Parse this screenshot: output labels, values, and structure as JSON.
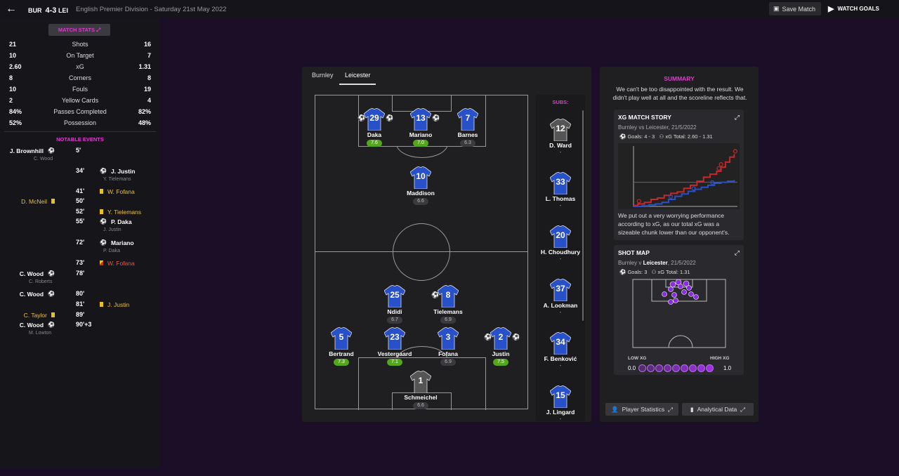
{
  "header": {
    "back_icon": "back-arrow-icon",
    "home_abbr": "BUR",
    "score": "4-3",
    "away_abbr": "LEI",
    "competition": "English Premier Division",
    "separator": " - ",
    "date": "Saturday 21st May 2022",
    "save_label": "Save Match",
    "watch_label": "WATCH GOALS"
  },
  "stats": {
    "title": "MATCH STATS",
    "rows": [
      {
        "home": "21",
        "label": "Shots",
        "away": "16"
      },
      {
        "home": "10",
        "label": "On Target",
        "away": "7"
      },
      {
        "home": "2.60",
        "label": "xG",
        "away": "1.31"
      },
      {
        "home": "8",
        "label": "Corners",
        "away": "8"
      },
      {
        "home": "10",
        "label": "Fouls",
        "away": "19"
      },
      {
        "home": "2",
        "label": "Yellow Cards",
        "away": "4"
      },
      {
        "home": "84%",
        "label": "Passes Completed",
        "away": "82%"
      },
      {
        "home": "52%",
        "label": "Possession",
        "away": "48%"
      }
    ]
  },
  "events": {
    "title": "NOTABLE EVENTS",
    "items": [
      {
        "side": "home",
        "name": "J. Brownhill",
        "type": "goal",
        "minute": "5'",
        "sub": "C. Wood"
      },
      {
        "side": "away",
        "name": "J. Justin",
        "type": "goal",
        "minute": "34'",
        "sub": "Y. Tielemans"
      },
      {
        "side": "away",
        "name": "W. Fofana",
        "type": "yellow",
        "minute": "41'",
        "sub": ""
      },
      {
        "side": "home",
        "name": "D. McNeil",
        "type": "yellow",
        "minute": "50'",
        "sub": ""
      },
      {
        "side": "away",
        "name": "Y. Tielemans",
        "type": "yellow",
        "minute": "52'",
        "sub": ""
      },
      {
        "side": "away",
        "name": "P. Daka",
        "type": "goal",
        "minute": "55'",
        "sub": "J. Justin"
      },
      {
        "side": "away",
        "name": "Mariano",
        "type": "goal",
        "minute": "72'",
        "sub": "P. Daka"
      },
      {
        "side": "away",
        "name": "W. Fofana",
        "type": "red",
        "minute": "73'",
        "sub": ""
      },
      {
        "side": "home",
        "name": "C. Wood",
        "type": "goal",
        "minute": "78'",
        "sub": "C. Roberts"
      },
      {
        "side": "home",
        "name": "C. Wood",
        "type": "goal",
        "minute": "80'",
        "sub": ""
      },
      {
        "side": "away",
        "name": "J. Justin",
        "type": "yellow",
        "minute": "81'",
        "sub": ""
      },
      {
        "side": "home",
        "name": "C. Taylor",
        "type": "yellow",
        "minute": "89'",
        "sub": ""
      },
      {
        "side": "home",
        "name": "C. Wood",
        "type": "goal",
        "minute": "90'+3",
        "sub": "M. Lowton"
      }
    ]
  },
  "tabs": [
    "Burnley",
    "Leicester"
  ],
  "active_tab": "Leicester",
  "players": [
    {
      "name": "Daka",
      "number": "29",
      "rating": "7.6",
      "good": true,
      "goalkeeper": false,
      "balls": "both"
    },
    {
      "name": "Mariano",
      "number": "13",
      "rating": "7.0",
      "good": true,
      "goalkeeper": false,
      "balls": "right"
    },
    {
      "name": "Barnes",
      "number": "7",
      "rating": "6.3",
      "good": false,
      "goalkeeper": false,
      "balls": ""
    },
    {
      "name": "Maddison",
      "number": "10",
      "rating": "6.6",
      "good": false,
      "goalkeeper": false,
      "balls": ""
    },
    {
      "name": "Ndidi",
      "number": "25",
      "rating": "6.7",
      "good": false,
      "goalkeeper": false,
      "balls": ""
    },
    {
      "name": "Tielemans",
      "number": "8",
      "rating": "6.9",
      "good": false,
      "goalkeeper": false,
      "balls": "left"
    },
    {
      "name": "Bertrand",
      "number": "5",
      "rating": "7.3",
      "good": true,
      "goalkeeper": false,
      "balls": ""
    },
    {
      "name": "Vestergaard",
      "number": "23",
      "rating": "7.1",
      "good": true,
      "goalkeeper": false,
      "balls": ""
    },
    {
      "name": "Fofana",
      "number": "3",
      "rating": "6.9",
      "good": false,
      "goalkeeper": false,
      "balls": ""
    },
    {
      "name": "Justin",
      "number": "2",
      "rating": "7.5",
      "good": true,
      "goalkeeper": false,
      "balls": "both"
    },
    {
      "name": "Schmeichel",
      "number": "1",
      "rating": "6.6",
      "good": false,
      "goalkeeper": true,
      "balls": ""
    }
  ],
  "subs": {
    "title": "SUBS:",
    "items": [
      {
        "name": "D. Ward",
        "number": "12",
        "goalkeeper": true,
        "value": "-"
      },
      {
        "name": "L. Thomas",
        "number": "33",
        "goalkeeper": false,
        "value": "-"
      },
      {
        "name": "H. Choudhury",
        "number": "20",
        "goalkeeper": false,
        "value": "-"
      },
      {
        "name": "A. Lookman",
        "number": "37",
        "goalkeeper": false,
        "value": "-"
      },
      {
        "name": "F. Benković",
        "number": "34",
        "goalkeeper": false,
        "value": "-"
      },
      {
        "name": "J. Lingard",
        "number": "15",
        "goalkeeper": false,
        "value": "-"
      }
    ]
  },
  "summary": {
    "title": "SUMMARY",
    "text": "We can't be too disappointed with the result. We didn't play well at all and the scoreline reflects that."
  },
  "xg_story": {
    "title": "XG MATCH STORY",
    "subtitle": "Burnley vs Leicester, 21/5/2022",
    "goals": "Goals: 4 - 3",
    "xg_total": "xG Total: 2.60 - 1.31",
    "text": "We put out a very worrying performance according to xG, as our total xG was a sizeable chunk lower than our opponent's.",
    "chart_data": {
      "type": "line",
      "title": "",
      "xlim": [
        0,
        95
      ],
      "ylim": [
        0,
        3
      ],
      "series": [
        {
          "color": "#c82828",
          "points": [
            [
              0,
              0.05
            ],
            [
              4,
              0.12
            ],
            [
              10,
              0.2
            ],
            [
              16,
              0.35
            ],
            [
              22,
              0.42
            ],
            [
              28,
              0.55
            ],
            [
              34,
              0.65
            ],
            [
              40,
              0.72
            ],
            [
              46,
              0.9
            ],
            [
              52,
              1.05
            ],
            [
              58,
              1.25
            ],
            [
              64,
              1.45
            ],
            [
              70,
              1.6
            ],
            [
              76,
              1.75
            ],
            [
              80,
              1.95
            ],
            [
              84,
              2.2
            ],
            [
              88,
              2.45
            ],
            [
              92,
              2.6
            ]
          ]
        },
        {
          "color": "#2850c8",
          "points": [
            [
              0,
              0.0
            ],
            [
              8,
              0.03
            ],
            [
              14,
              0.08
            ],
            [
              20,
              0.12
            ],
            [
              26,
              0.2
            ],
            [
              32,
              0.35
            ],
            [
              38,
              0.5
            ],
            [
              44,
              0.62
            ],
            [
              50,
              0.75
            ],
            [
              56,
              0.85
            ],
            [
              62,
              0.95
            ],
            [
              68,
              1.05
            ],
            [
              74,
              1.15
            ],
            [
              80,
              1.2
            ],
            [
              86,
              1.25
            ],
            [
              92,
              1.31
            ]
          ]
        }
      ],
      "goals": [
        {
          "color": "#c82828",
          "x": 5
        },
        {
          "color": "#2850c8",
          "x": 34
        },
        {
          "color": "#2850c8",
          "x": 55
        },
        {
          "color": "#2850c8",
          "x": 72
        },
        {
          "color": "#c82828",
          "x": 78
        },
        {
          "color": "#c82828",
          "x": 80
        },
        {
          "color": "#c82828",
          "x": 93
        }
      ]
    }
  },
  "shot_map": {
    "title": "SHOT MAP",
    "subtitle_prefix": "Burnley v ",
    "subtitle_team": "Leicester",
    "subtitle_suffix": ", 21/5/2022",
    "goals": "Goals: 3",
    "xg_total": "xG Total: 1.31",
    "low_label": "LOW XG",
    "high_label": "HIGH XG",
    "min_value": "0.0",
    "max_value": "1.0",
    "scale_steps": 9
  },
  "buttons": {
    "player_stats": "Player Statistics",
    "analytical": "Analytical Data"
  },
  "colors": {
    "accent": "#e03ad0",
    "kit": "#2850c8",
    "good_rating": "#52a818",
    "home_xg": "#c82828",
    "away_xg": "#2850c8"
  }
}
